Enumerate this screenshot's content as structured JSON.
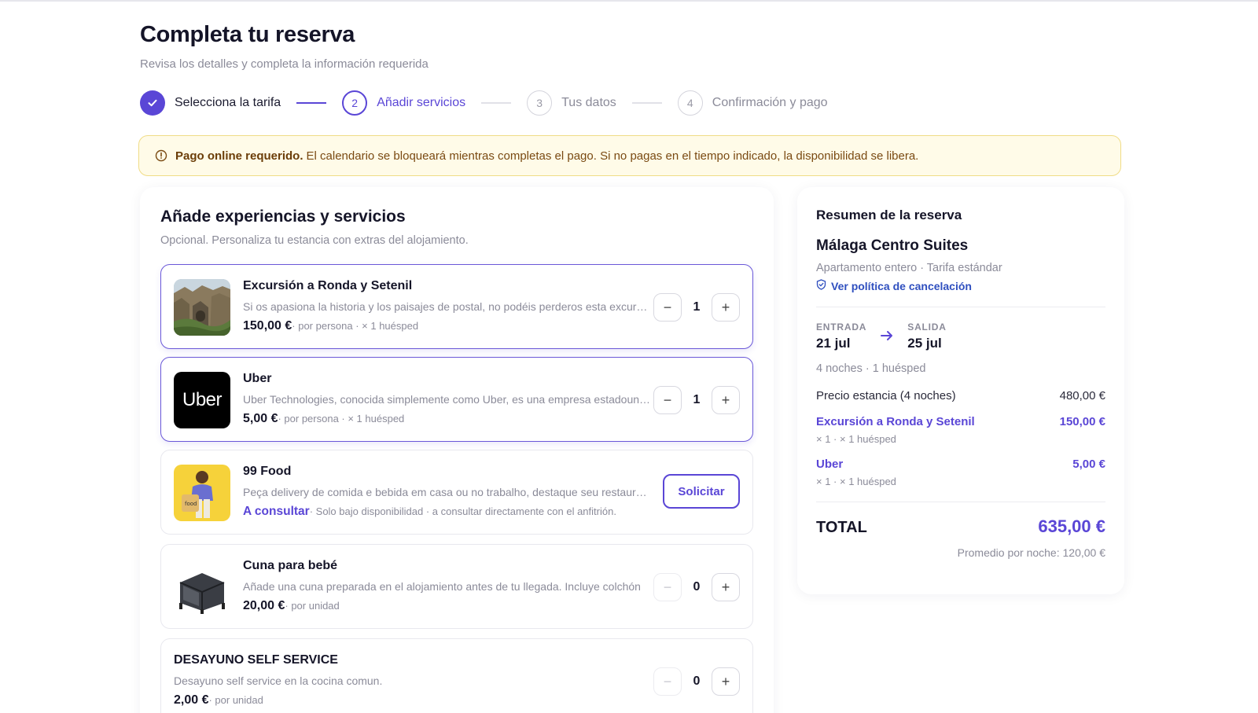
{
  "header": {
    "title": "Completa tu reserva",
    "subtitle": "Revisa los detalles y completa la información requerida"
  },
  "stepper": {
    "steps": [
      {
        "number": "",
        "label": "Selecciona la tarifa",
        "state": "done"
      },
      {
        "number": "2",
        "label": "Añadir servicios",
        "state": "active"
      },
      {
        "number": "3",
        "label": "Tus datos",
        "state": "pending"
      },
      {
        "number": "4",
        "label": "Confirmación y pago",
        "state": "pending"
      }
    ]
  },
  "alert": {
    "bold": "Pago online requerido.",
    "text": "El calendario se bloqueará mientras completas el pago. Si no pagas en el tiempo indicado, la disponibilidad se libera."
  },
  "services_panel": {
    "title": "Añade experiencias y servicios",
    "description": "Opcional. Personaliza tu estancia con extras del alojamiento.",
    "items": [
      {
        "name": "Excursión a Ronda y Setenil",
        "description": "Si os apasiona la historia y los paisajes de postal, no podéis perderos esta excursión a Ronda y Setenil",
        "price": "150,00 €",
        "price_note": "· por persona · × 1 huésped",
        "quantity": "1",
        "selected": true,
        "image": "ronda-landscape"
      },
      {
        "name": "Uber",
        "description": "Uber Technologies, conocida simplemente como Uber, es una empresa estadounidense",
        "price": "5,00 €",
        "price_note": "· por persona · × 1 huésped",
        "quantity": "1",
        "selected": true,
        "image": "uber-logo",
        "logo_text": "Uber"
      },
      {
        "name": "99 Food",
        "description": "Peça delivery de comida e bebida em casa ou no trabalho, destaque seu restaurante",
        "price": "A consultar",
        "price_note": "· Solo bajo disponibilidad · a consultar directamente con el anfitrión.",
        "action": "Solicitar",
        "selected": false,
        "image": "99food-person"
      },
      {
        "name": "Cuna para bebé",
        "description": "Añade una cuna preparada en el alojamiento antes de tu llegada. Incluye colchón",
        "price": "20,00 €",
        "price_note": "· por unidad",
        "quantity": "0",
        "selected": false,
        "image": "baby-crib"
      },
      {
        "name": "DESAYUNO SELF SERVICE",
        "description": "Desayuno self service en la cocina comun.",
        "price": "2,00 €",
        "price_note": "· por unidad",
        "quantity": "0",
        "selected": false,
        "image": ""
      }
    ],
    "minus": "−",
    "plus": "+"
  },
  "summary": {
    "title": "Resumen de la reserva",
    "hotel": "Málaga Centro Suites",
    "type": "Apartamento entero · Tarifa estándar",
    "policy_link": "Ver política de cancelación",
    "checkin_label": "ENTRADA",
    "checkin": "21 jul",
    "checkout_label": "SALIDA",
    "checkout": "25 jul",
    "nights": "4 noches · 1 huésped",
    "stay_label": "Precio estancia (4 noches)",
    "stay_price": "480,00 €",
    "extras": [
      {
        "name": "Excursión a Ronda y Setenil",
        "price": "150,00 €",
        "detail": "× 1 · × 1 huésped"
      },
      {
        "name": "Uber",
        "price": "5,00 €",
        "detail": "× 1 · × 1 huésped"
      }
    ],
    "total_label": "TOTAL",
    "total": "635,00 €",
    "average": "Promedio por noche: 120,00 €"
  },
  "colors": {
    "accent": "#5a46d6",
    "alert_bg": "#fffbe8",
    "alert_border": "#f0dc86"
  }
}
